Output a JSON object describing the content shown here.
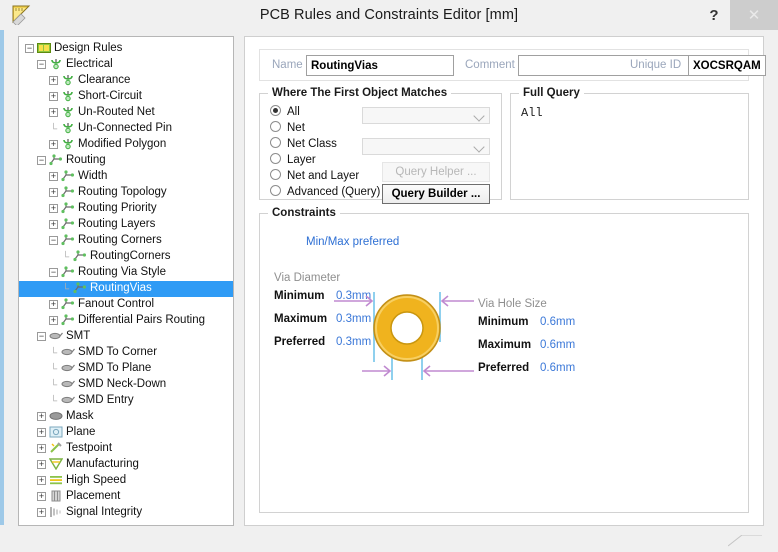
{
  "window": {
    "title": "PCB Rules and Constraints Editor [mm]",
    "icon": "ruler-icon",
    "help_label": "?",
    "close_label": "✕"
  },
  "tree": {
    "items": [
      {
        "label": "Design Rules",
        "depth": 0,
        "expander": "minus",
        "icon": "design-rules-icon",
        "selected": false
      },
      {
        "label": "Electrical",
        "depth": 1,
        "expander": "minus",
        "icon": "electrical-icon",
        "selected": false
      },
      {
        "label": "Clearance",
        "depth": 2,
        "expander": "plus",
        "icon": "electrical-icon",
        "selected": false
      },
      {
        "label": "Short-Circuit",
        "depth": 2,
        "expander": "plus",
        "icon": "electrical-icon",
        "selected": false
      },
      {
        "label": "Un-Routed Net",
        "depth": 2,
        "expander": "plus",
        "icon": "electrical-icon",
        "selected": false
      },
      {
        "label": "Un-Connected Pin",
        "depth": 2,
        "expander": "none",
        "icon": "electrical-icon",
        "selected": false
      },
      {
        "label": "Modified Polygon",
        "depth": 2,
        "expander": "plus",
        "icon": "electrical-icon",
        "selected": false
      },
      {
        "label": "Routing",
        "depth": 1,
        "expander": "minus",
        "icon": "routing-icon",
        "selected": false
      },
      {
        "label": "Width",
        "depth": 2,
        "expander": "plus",
        "icon": "routing-icon",
        "selected": false
      },
      {
        "label": "Routing Topology",
        "depth": 2,
        "expander": "plus",
        "icon": "routing-icon",
        "selected": false
      },
      {
        "label": "Routing Priority",
        "depth": 2,
        "expander": "plus",
        "icon": "routing-icon",
        "selected": false
      },
      {
        "label": "Routing Layers",
        "depth": 2,
        "expander": "plus",
        "icon": "routing-icon",
        "selected": false
      },
      {
        "label": "Routing Corners",
        "depth": 2,
        "expander": "minus",
        "icon": "routing-icon",
        "selected": false
      },
      {
        "label": "RoutingCorners",
        "depth": 3,
        "expander": "none",
        "icon": "routing-icon",
        "selected": false
      },
      {
        "label": "Routing Via Style",
        "depth": 2,
        "expander": "minus",
        "icon": "routing-icon",
        "selected": false
      },
      {
        "label": "RoutingVias",
        "depth": 3,
        "expander": "none",
        "icon": "routing-icon",
        "selected": true
      },
      {
        "label": "Fanout Control",
        "depth": 2,
        "expander": "plus",
        "icon": "routing-icon",
        "selected": false
      },
      {
        "label": "Differential Pairs Routing",
        "depth": 2,
        "expander": "plus",
        "icon": "routing-icon",
        "selected": false
      },
      {
        "label": "SMT",
        "depth": 1,
        "expander": "minus",
        "icon": "smt-icon",
        "selected": false
      },
      {
        "label": "SMD To Corner",
        "depth": 2,
        "expander": "none",
        "icon": "smt-icon",
        "selected": false
      },
      {
        "label": "SMD To Plane",
        "depth": 2,
        "expander": "none",
        "icon": "smt-icon",
        "selected": false
      },
      {
        "label": "SMD Neck-Down",
        "depth": 2,
        "expander": "none",
        "icon": "smt-icon",
        "selected": false
      },
      {
        "label": "SMD Entry",
        "depth": 2,
        "expander": "none",
        "icon": "smt-icon",
        "selected": false
      },
      {
        "label": "Mask",
        "depth": 1,
        "expander": "plus",
        "icon": "mask-icon",
        "selected": false
      },
      {
        "label": "Plane",
        "depth": 1,
        "expander": "plus",
        "icon": "plane-icon",
        "selected": false
      },
      {
        "label": "Testpoint",
        "depth": 1,
        "expander": "plus",
        "icon": "testpoint-icon",
        "selected": false
      },
      {
        "label": "Manufacturing",
        "depth": 1,
        "expander": "plus",
        "icon": "manufacturing-icon",
        "selected": false
      },
      {
        "label": "High Speed",
        "depth": 1,
        "expander": "plus",
        "icon": "high-speed-icon",
        "selected": false
      },
      {
        "label": "Placement",
        "depth": 1,
        "expander": "plus",
        "icon": "placement-icon",
        "selected": false
      },
      {
        "label": "Signal Integrity",
        "depth": 1,
        "expander": "plus",
        "icon": "signal-integrity-icon",
        "selected": false
      }
    ]
  },
  "header": {
    "name_label": "Name",
    "name_value": "RoutingVias",
    "comment_label": "Comment",
    "comment_value": "",
    "comment_placeholder": "",
    "unique_id_label": "Unique ID",
    "unique_id_value": "XOCSRQAM"
  },
  "matches": {
    "title": "Where The First Object Matches",
    "options": [
      {
        "label": "All",
        "selected": true
      },
      {
        "label": "Net",
        "selected": false
      },
      {
        "label": "Net Class",
        "selected": false
      },
      {
        "label": "Layer",
        "selected": false
      },
      {
        "label": "Net and Layer",
        "selected": false
      },
      {
        "label": "Advanced (Query)",
        "selected": false
      }
    ],
    "net_combo_value": "",
    "net_class_combo_value": "",
    "query_helper_label": "Query Helper ...",
    "query_builder_label": "Query Builder ..."
  },
  "full_query": {
    "title": "Full Query",
    "text": "All"
  },
  "constraints": {
    "title": "Constraints",
    "preference_link": "Min/Max preferred",
    "via_diameter": {
      "title": "Via Diameter",
      "minimum_label": "Minimum",
      "minimum_value": "0.3mm",
      "maximum_label": "Maximum",
      "maximum_value": "0.3mm",
      "preferred_label": "Preferred",
      "preferred_value": "0.3mm"
    },
    "via_hole_size": {
      "title": "Via Hole Size",
      "minimum_label": "Minimum",
      "minimum_value": "0.6mm",
      "maximum_label": "Maximum",
      "maximum_value": "0.6mm",
      "preferred_label": "Preferred",
      "preferred_value": "0.6mm"
    },
    "colors": {
      "via_fill": "#f0b31e",
      "via_edge": "#a87a12",
      "guide_line": "#8fd0ee",
      "dimension_arrow": "#c08ad0",
      "value_text": "#3b78d8",
      "link_text": "#2d6fd4"
    }
  }
}
